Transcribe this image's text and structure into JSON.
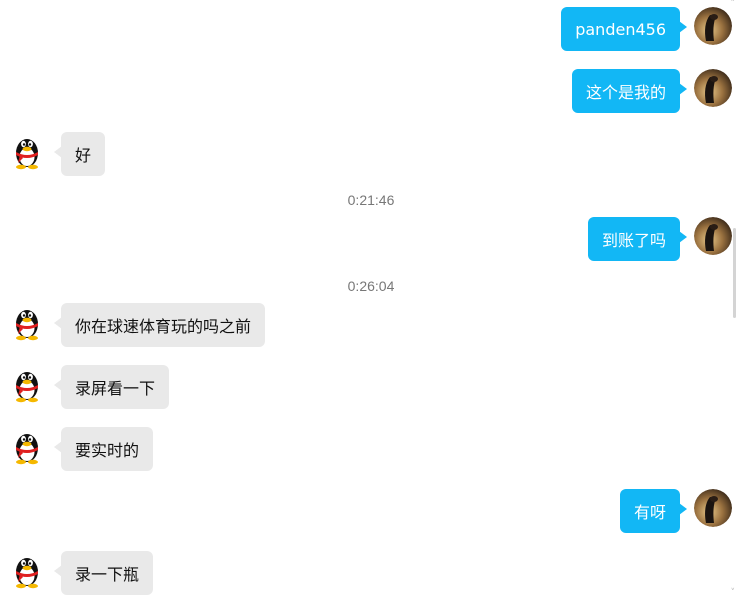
{
  "window": {
    "title": ""
  },
  "colors": {
    "outgoing_bubble": "#12b7f5",
    "incoming_bubble": "#e9e9e9",
    "timestamp_text": "#777777"
  },
  "messages": [
    {
      "direction": "out",
      "text": "panden456",
      "avatar": "user-avatar-icon"
    },
    {
      "direction": "out",
      "text": "这个是我的",
      "avatar": "user-avatar-icon"
    },
    {
      "direction": "in",
      "text": "好",
      "avatar": "qq-penguin-icon"
    },
    {
      "type": "time",
      "text": "0:21:46"
    },
    {
      "direction": "out",
      "text": "到账了吗",
      "avatar": "user-avatar-icon"
    },
    {
      "type": "time",
      "text": "0:26:04"
    },
    {
      "direction": "in",
      "text": "你在球速体育玩的吗之前",
      "avatar": "qq-penguin-icon"
    },
    {
      "direction": "in",
      "text": "录屏看一下",
      "avatar": "qq-penguin-icon"
    },
    {
      "direction": "in",
      "text": "要实时的",
      "avatar": "qq-penguin-icon"
    },
    {
      "direction": "out",
      "text": "有呀",
      "avatar": "user-avatar-icon"
    },
    {
      "direction": "in",
      "text": "录一下瓶",
      "avatar": "qq-penguin-icon"
    }
  ],
  "scrollbar": {
    "up_arrow": "˄",
    "down_arrow": "˅"
  }
}
